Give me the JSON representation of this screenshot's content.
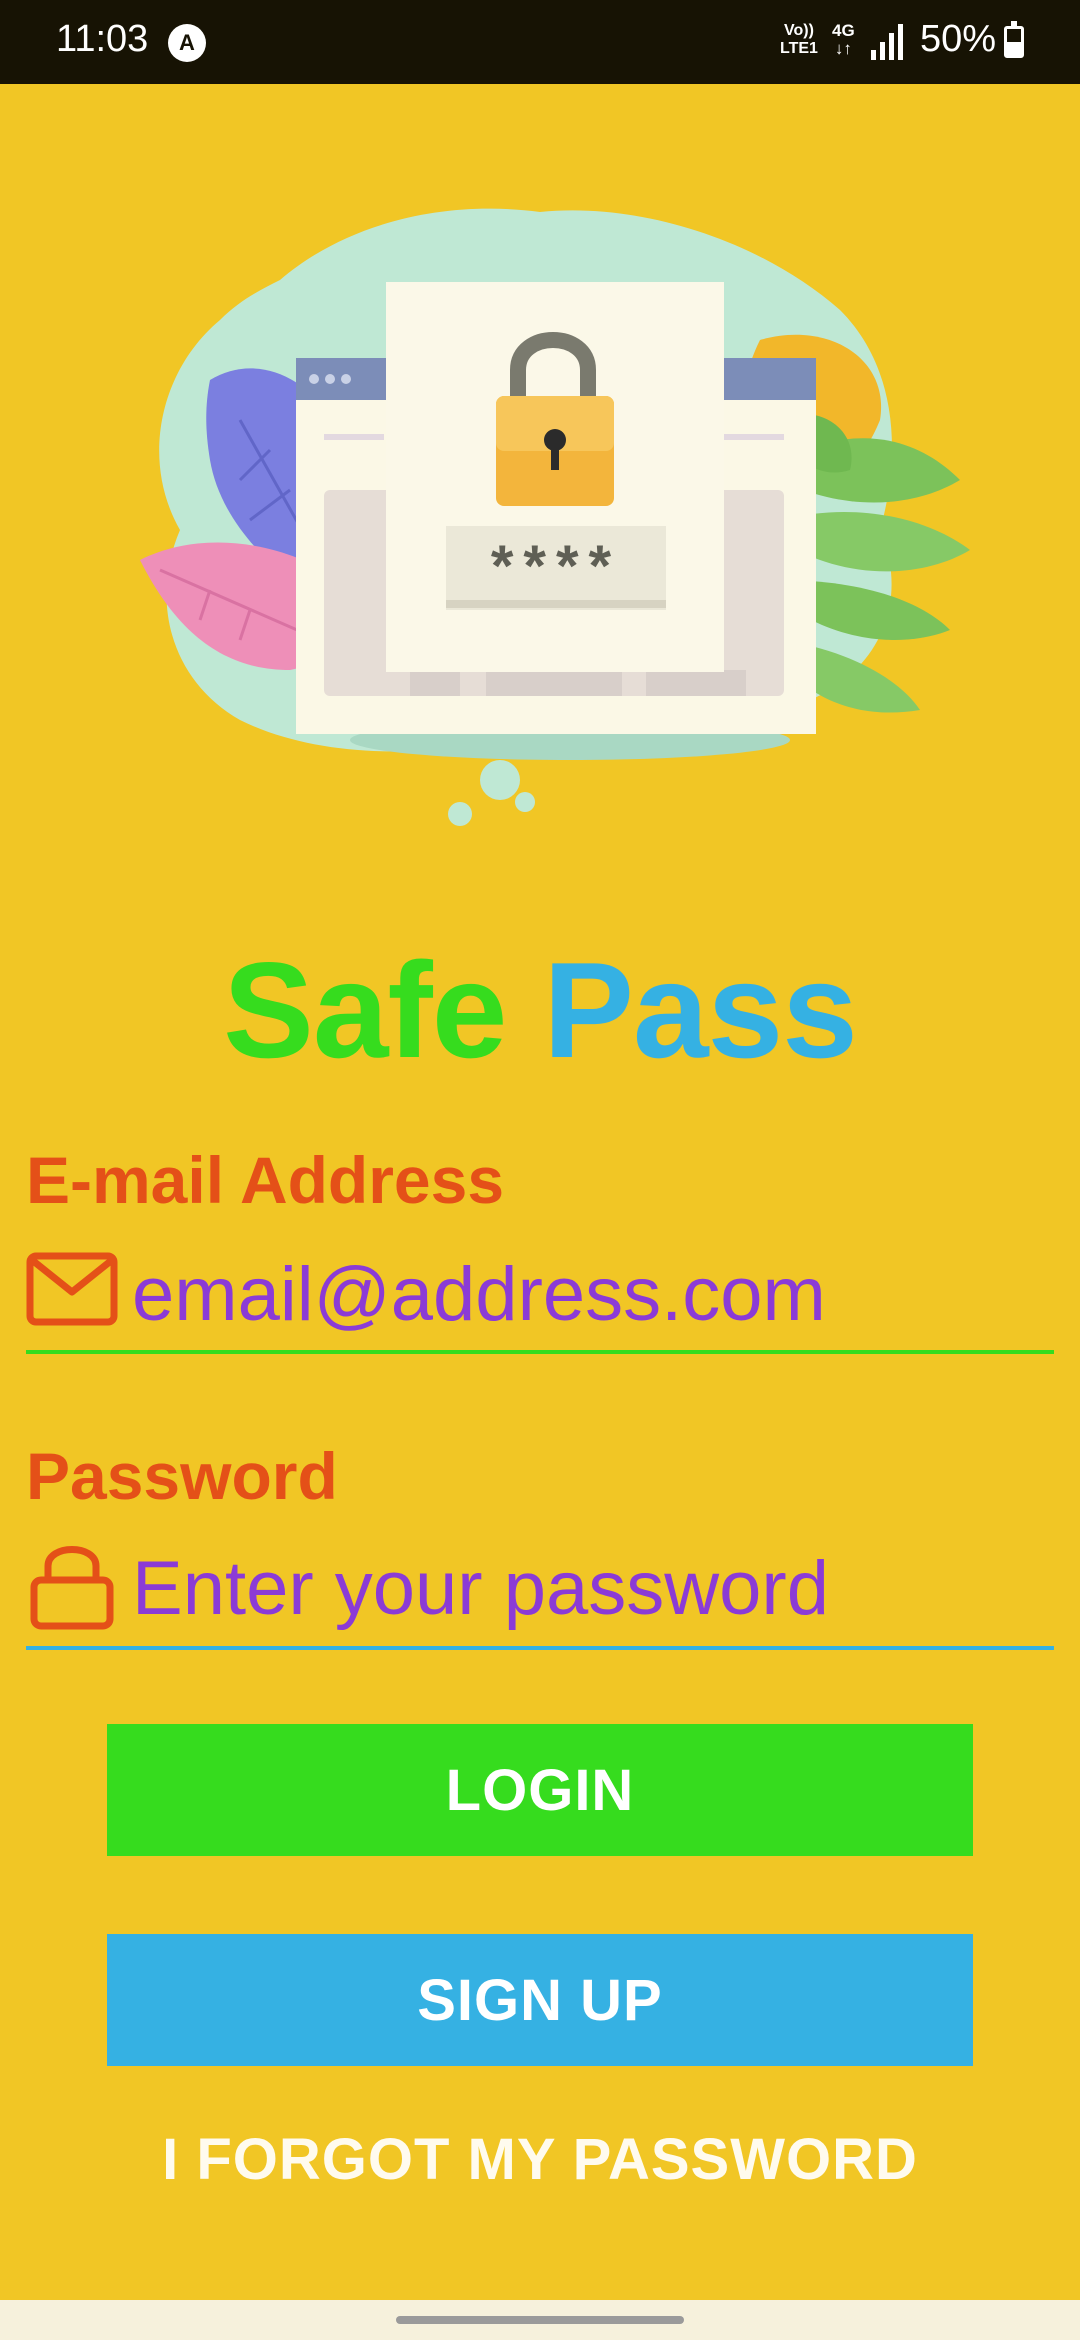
{
  "status_bar": {
    "time": "11:03",
    "auto_badge": "A",
    "volte_line1": "Vo))",
    "volte_line2": "LTE1",
    "network": "4G",
    "network_arrows": "↓↑",
    "battery_percent": "50%",
    "battery_level": 0.5
  },
  "illustration": {
    "password_mask": "****",
    "icon": "padlock-illustration"
  },
  "title": {
    "part1": "Safe",
    "part2": "Pass",
    "colors": {
      "part1": "#36dc1e",
      "part2": "#35b1e3"
    }
  },
  "email": {
    "label": "E-mail Address",
    "value": "email@address.com",
    "icon": "mail-icon",
    "underline_color": "#36dc1e"
  },
  "password": {
    "label": "Password",
    "placeholder": "Enter your password",
    "icon": "lock-icon",
    "underline_color": "#35b1e3"
  },
  "buttons": {
    "login": "LOGIN",
    "signup": "SIGN UP",
    "forgot": "I FORGOT MY PASSWORD"
  },
  "colors": {
    "background": "#f1c625",
    "label": "#e45018",
    "input_text": "#8b3bd6",
    "login_button": "#36dc1e",
    "signup_button": "#35b1e3"
  }
}
